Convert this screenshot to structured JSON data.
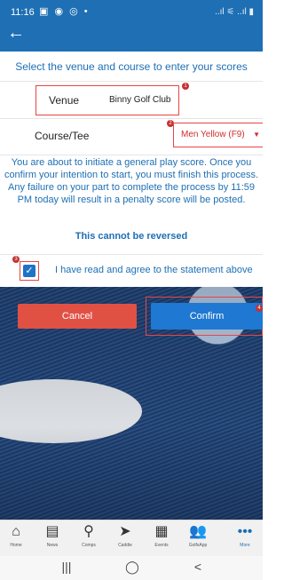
{
  "status_bar": {
    "time": "11:16",
    "icons": "▣ ◉ ◎ •",
    "right_icons": "..ıl ⚟ ..ıl ▮"
  },
  "app_bar": {
    "back_glyph": "←"
  },
  "form": {
    "intro": "Select the venue and course to enter your scores",
    "venue_label": "Venue",
    "venue_value": "Binny Golf Club",
    "course_label": "Course/Tee",
    "tee_value": "Men Yellow (F9)",
    "tee_caret": "▼",
    "warning": "You are about to initiate a general play score. Once you confirm your intention to start, you must finish this process. Any failure on your part to complete the process by 11:59 PM today will result in a penalty score will be posted.",
    "irreversible": "This cannot be reversed",
    "agree_text": "I have read and agree to the statement above",
    "agree_checked": true,
    "check_glyph": "✓"
  },
  "badges": {
    "b1": "1",
    "b2": "2",
    "b3": "3",
    "b4": "4"
  },
  "actions": {
    "cancel_label": "Cancel",
    "confirm_label": "Confirm"
  },
  "bottom_nav": [
    {
      "label": "Home",
      "icon": "home-icon",
      "glyph": "⌂"
    },
    {
      "label": "News",
      "icon": "news-icon",
      "glyph": "▤"
    },
    {
      "label": "Comps",
      "icon": "medal-icon",
      "glyph": "⚲"
    },
    {
      "label": "Caddie",
      "icon": "navigation-icon",
      "glyph": "➤"
    },
    {
      "label": "Events",
      "icon": "calendar-icon",
      "glyph": "▦"
    },
    {
      "label": "GolfsApp",
      "icon": "people-icon",
      "glyph": "👥"
    },
    {
      "label": "More",
      "icon": "more-icon",
      "glyph": "•••"
    }
  ],
  "system_nav": {
    "recents": "|||",
    "home": "◯",
    "back": "<"
  },
  "colors": {
    "primary": "#1e6fb4",
    "cancel": "#e05144",
    "confirm": "#1f78d1",
    "highlight": "#e64545"
  }
}
